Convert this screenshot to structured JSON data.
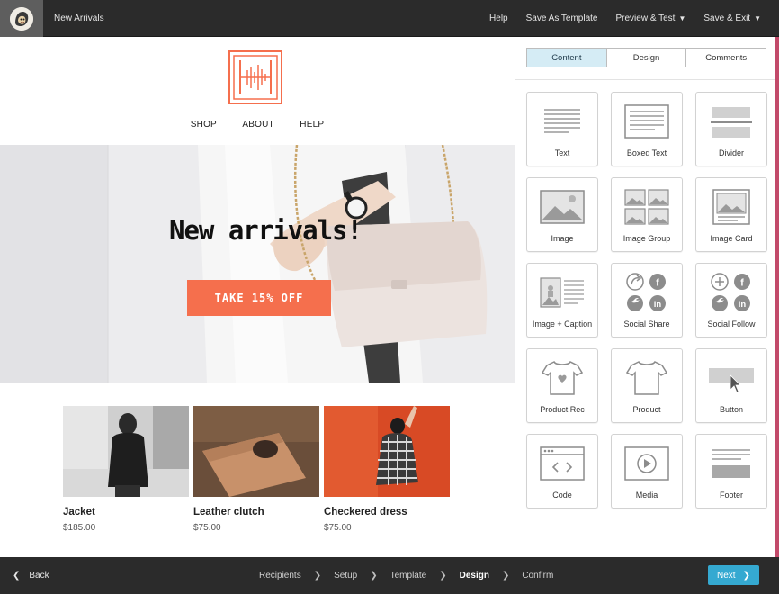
{
  "topbar": {
    "logo": "mailchimp-freddie-logo",
    "title": "New Arrivals",
    "actions": [
      {
        "label": "Help",
        "has_dropdown": false
      },
      {
        "label": "Save As Template",
        "has_dropdown": false
      },
      {
        "label": "Preview & Test",
        "has_dropdown": true
      },
      {
        "label": "Save & Exit",
        "has_dropdown": true
      }
    ]
  },
  "email": {
    "brand_color": "#f56f4d",
    "nav": [
      "SHOP",
      "ABOUT",
      "HELP"
    ],
    "hero": {
      "title": "New arrivals!",
      "cta_label": "TAKE 15% OFF",
      "image": "woman-holding-white-handbag-photo"
    },
    "products": [
      {
        "name": "Jacket",
        "price": "$185.00",
        "image": "woman-in-leather-jacket-photo"
      },
      {
        "name": "Leather clutch",
        "price": "$75.00",
        "image": "tan-leather-clutch-photo"
      },
      {
        "name": "Checkered dress",
        "price": "$75.00",
        "image": "woman-in-checkered-dress-photo"
      }
    ]
  },
  "sidepanel": {
    "tabs": [
      {
        "label": "Content",
        "active": true
      },
      {
        "label": "Design",
        "active": false
      },
      {
        "label": "Comments",
        "active": false
      }
    ],
    "blocks": [
      {
        "label": "Text",
        "icon": "text-lines-icon"
      },
      {
        "label": "Boxed Text",
        "icon": "boxed-text-icon"
      },
      {
        "label": "Divider",
        "icon": "divider-icon"
      },
      {
        "label": "Image",
        "icon": "image-icon"
      },
      {
        "label": "Image Group",
        "icon": "image-group-icon"
      },
      {
        "label": "Image Card",
        "icon": "image-card-icon"
      },
      {
        "label": "Image + Caption",
        "icon": "image-caption-icon"
      },
      {
        "label": "Social Share",
        "icon": "social-share-icon"
      },
      {
        "label": "Social Follow",
        "icon": "social-follow-icon"
      },
      {
        "label": "Product Rec",
        "icon": "product-rec-icon"
      },
      {
        "label": "Product",
        "icon": "product-tshirt-icon"
      },
      {
        "label": "Button",
        "icon": "button-cursor-icon"
      },
      {
        "label": "Code",
        "icon": "code-window-icon"
      },
      {
        "label": "Media",
        "icon": "media-play-icon"
      },
      {
        "label": "Footer",
        "icon": "footer-icon"
      }
    ]
  },
  "bottombar": {
    "back_label": "Back",
    "steps": [
      {
        "label": "Recipients",
        "current": false
      },
      {
        "label": "Setup",
        "current": false
      },
      {
        "label": "Template",
        "current": false
      },
      {
        "label": "Design",
        "current": true
      },
      {
        "label": "Confirm",
        "current": false
      }
    ],
    "next_label": "Next"
  },
  "colors": {
    "topbar_bg": "#2b2b2b",
    "accent_blue": "#35a9d1",
    "active_tab_bg": "#d5ecf5",
    "cta_orange": "#f56f4d"
  }
}
